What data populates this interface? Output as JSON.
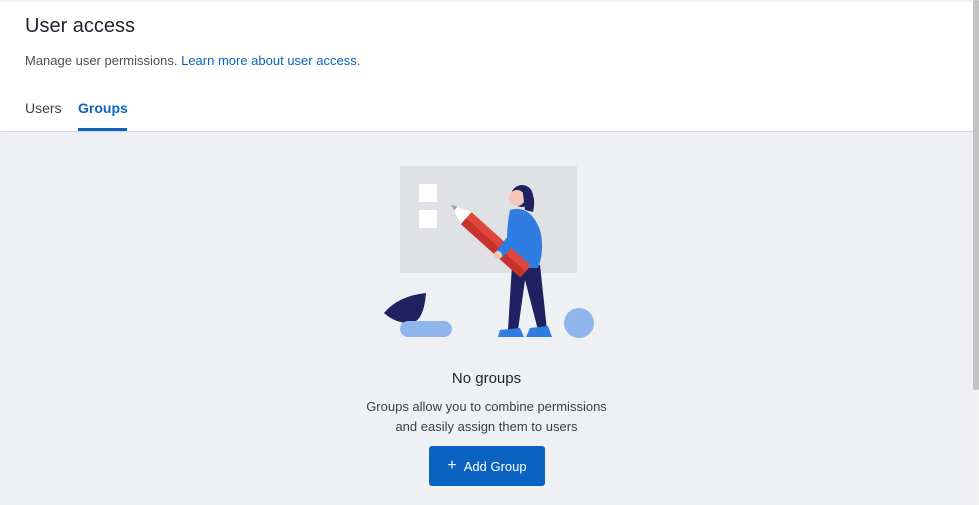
{
  "header": {
    "title": "User access",
    "subtitle": "Manage user permissions.",
    "learn_more_link": "Learn more about user access."
  },
  "tabs": [
    {
      "label": "Users",
      "active": false
    },
    {
      "label": "Groups",
      "active": true
    }
  ],
  "empty_state": {
    "title": "No groups",
    "description_line1": "Groups allow you to combine permissions",
    "description_line2": "and easily assign them to users",
    "button_icon": "plus-icon",
    "button_label": "Add Group"
  },
  "colors": {
    "accent": "#0b63c1",
    "background": "#eef0f4",
    "pencil": "#e2453c",
    "figure_navy": "#1f2160",
    "figure_blue": "#2f7de1"
  }
}
